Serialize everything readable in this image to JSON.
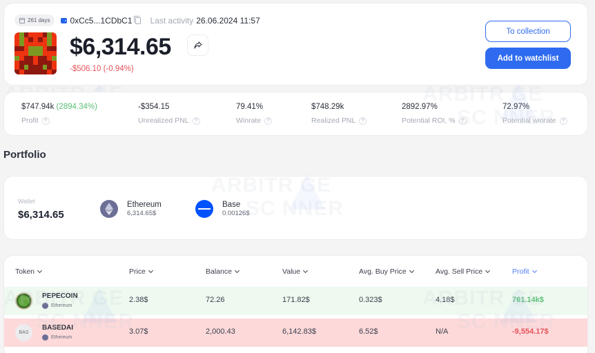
{
  "header": {
    "days_badge": "261 days",
    "address": "0xCc5...1CDbC1",
    "last_activity_label": "Last activity",
    "last_activity_value": "26.06.2024 11:57",
    "balance": "$6,314.65",
    "change": "-$506.10 (-0.94%)",
    "buttons": {
      "to_collection": "To collection",
      "add_to_watchlist": "Add to watchlist"
    },
    "avatar_grid": [
      "RGDRRRDGR",
      "RGRDRDRGR",
      "RGRRRRRGR",
      "DDRGGGRDD",
      "RRRGGGRRR",
      "GRDDRDDRG",
      "RDDDRDDDR",
      "RDGDDDGDR",
      "DRDDDDDRD"
    ],
    "avatar_colors": {
      "R": "#ee3310",
      "G": "#7c9a22",
      "D": "#8c1810"
    }
  },
  "stats": [
    {
      "value": "$747.94k",
      "extra": "(2894.34%)",
      "label": "Profit"
    },
    {
      "value": "-$354.15",
      "extra": "",
      "label": "Unrealized PNL"
    },
    {
      "value": "79.41%",
      "extra": "",
      "label": "Winrate"
    },
    {
      "value": "$748.29k",
      "extra": "",
      "label": "Realized PNL"
    },
    {
      "value": "2892.97%",
      "extra": "",
      "label": "Potential ROI, %"
    },
    {
      "value": "72.97%",
      "extra": "",
      "label": "Potential winrate"
    }
  ],
  "help_glyph": "?",
  "portfolio": {
    "title": "Portfolio",
    "wallet_label": "Wallet",
    "wallet_value": "$6,314.65",
    "chains": [
      {
        "name": "Ethereum",
        "amount": "6,314.65$",
        "icon": "ethereum-icon"
      },
      {
        "name": "Base",
        "amount": "0.00126$",
        "icon": "base-icon"
      }
    ]
  },
  "table": {
    "columns": [
      "Token",
      "Price",
      "Balance",
      "Value",
      "Avg. Buy Price",
      "Avg. Sell Price",
      "Profit"
    ],
    "active_column": "Profit",
    "rows": [
      {
        "token": "PEPECOIN",
        "chain": "Ethereum",
        "logo_text": "",
        "price": "2.38$",
        "balance": "72.26",
        "value": "171.82$",
        "avg_buy": "0.323$",
        "avg_sell": "4.18$",
        "profit": "761.14k$",
        "status": "positive"
      },
      {
        "token": "BASEDAI",
        "chain": "Ethereum",
        "logo_text": "BAS",
        "price": "3.07$",
        "balance": "2,000.43",
        "value": "6,142.83$",
        "avg_buy": "6.52$",
        "avg_sell": "N/A",
        "profit": "-9,554.17$",
        "status": "negative"
      }
    ]
  },
  "watermark": {
    "line1": "ARBITR GE",
    "line2": "SC NNER"
  },
  "colors": {
    "accent": "#2f6bf0",
    "positive": "#5bbf76",
    "negative": "#e5535b",
    "row_positive_bg": "#eef9f0",
    "row_negative_bg": "#fdd9da"
  }
}
